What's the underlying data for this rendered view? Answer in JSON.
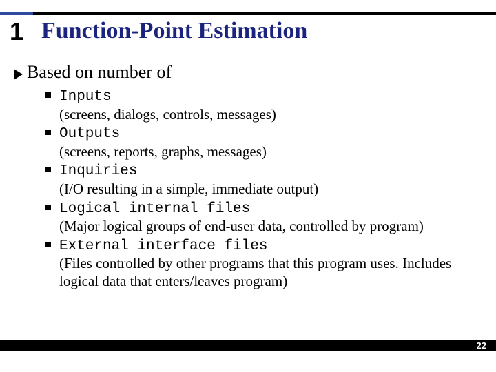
{
  "slide": {
    "number": "1",
    "title": "Function-Point Estimation",
    "lead": "Based on number of",
    "items": [
      {
        "term": "Inputs",
        "desc": "(screens, dialogs, controls, messages)"
      },
      {
        "term": "Outputs",
        "desc": "(screens, reports, graphs, messages)"
      },
      {
        "term": "Inquiries",
        "desc": "(I/O resulting in a simple, immediate output)"
      },
      {
        "term": "Logical internal files",
        "desc": "(Major logical groups of end-user data, controlled by program)"
      },
      {
        "term": "External interface files",
        "desc": "(Files controlled by other programs that this program uses.  Includes logical data that enters/leaves program)"
      }
    ],
    "page": "22"
  },
  "colors": {
    "title": "#1a237e",
    "accent_blue": "#2b4aa0"
  }
}
